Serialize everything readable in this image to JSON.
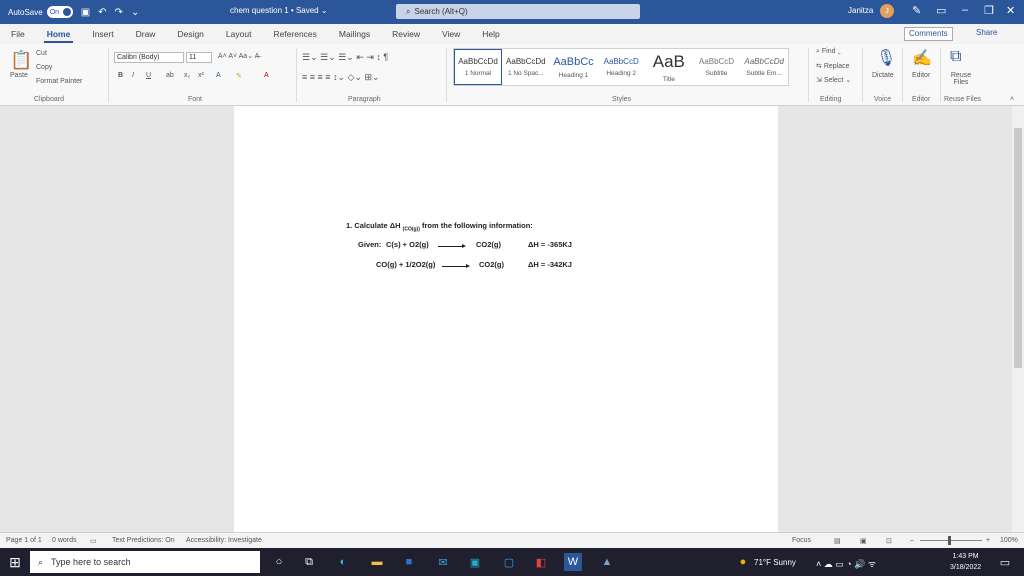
{
  "titlebar": {
    "autosave_label": "AutoSave",
    "autosave_state": "On",
    "doc_title": "chem question 1 • Saved ⌄",
    "search_placeholder": "Search (Alt+Q)",
    "user_name": "Janitza",
    "avatar_initial": "J"
  },
  "menu": {
    "tabs": [
      "File",
      "Home",
      "Insert",
      "Draw",
      "Design",
      "Layout",
      "References",
      "Mailings",
      "Review",
      "View",
      "Help"
    ],
    "active": "Home",
    "comments": "Comments",
    "share": "Share"
  },
  "ribbon": {
    "clipboard": {
      "paste": "Paste",
      "cut": "Cut",
      "copy": "Copy",
      "format_painter": "Format Painter",
      "label": "Clipboard"
    },
    "font": {
      "family": "Calibri (Body)",
      "size": "11",
      "label": "Font"
    },
    "paragraph": {
      "label": "Paragraph"
    },
    "styles": {
      "label": "Styles",
      "items": [
        {
          "preview": "AaBbCcDd",
          "name": "1 Normal"
        },
        {
          "preview": "AaBbCcDd",
          "name": "1 No Spac..."
        },
        {
          "preview": "AaBbCc",
          "name": "Heading 1"
        },
        {
          "preview": "AaBbCcD",
          "name": "Heading 2"
        },
        {
          "preview": "AaB",
          "name": "Title"
        },
        {
          "preview": "AaBbCcD",
          "name": "Subtitle"
        },
        {
          "preview": "AaBbCcDd",
          "name": "Subtle Em..."
        }
      ]
    },
    "editing": {
      "find": "Find",
      "replace": "Replace",
      "select": "Select",
      "label": "Editing"
    },
    "voice": {
      "dictate": "Dictate",
      "label": "Voice"
    },
    "editor": {
      "editor": "Editor",
      "label": "Editor"
    },
    "reuse": {
      "reuse": "Reuse Files",
      "label": "Reuse Files"
    }
  },
  "document": {
    "question": "1. Calculate ΔH",
    "question_sub": "(CO(g))",
    "question_rest": "from the following information:",
    "given_label": "Given:",
    "eq1_left": "C(s) + O2(g)",
    "eq1_right": "CO2(g)",
    "eq1_dh": "ΔH = -365KJ",
    "eq2_left": "CO(g) + 1/2O2(g)",
    "eq2_right": "CO2(g)",
    "eq2_dh": "ΔH = -342KJ"
  },
  "status": {
    "page": "Page 1 of 1",
    "words": "0 words",
    "text_predictions": "Text Predictions: On",
    "accessibility": "Accessibility: Investigate",
    "focus": "Focus",
    "zoom": "100%"
  },
  "taskbar": {
    "search_placeholder": "Type here to search",
    "weather": "71°F Sunny",
    "time": "1:43 PM",
    "date": "3/18/2022"
  }
}
